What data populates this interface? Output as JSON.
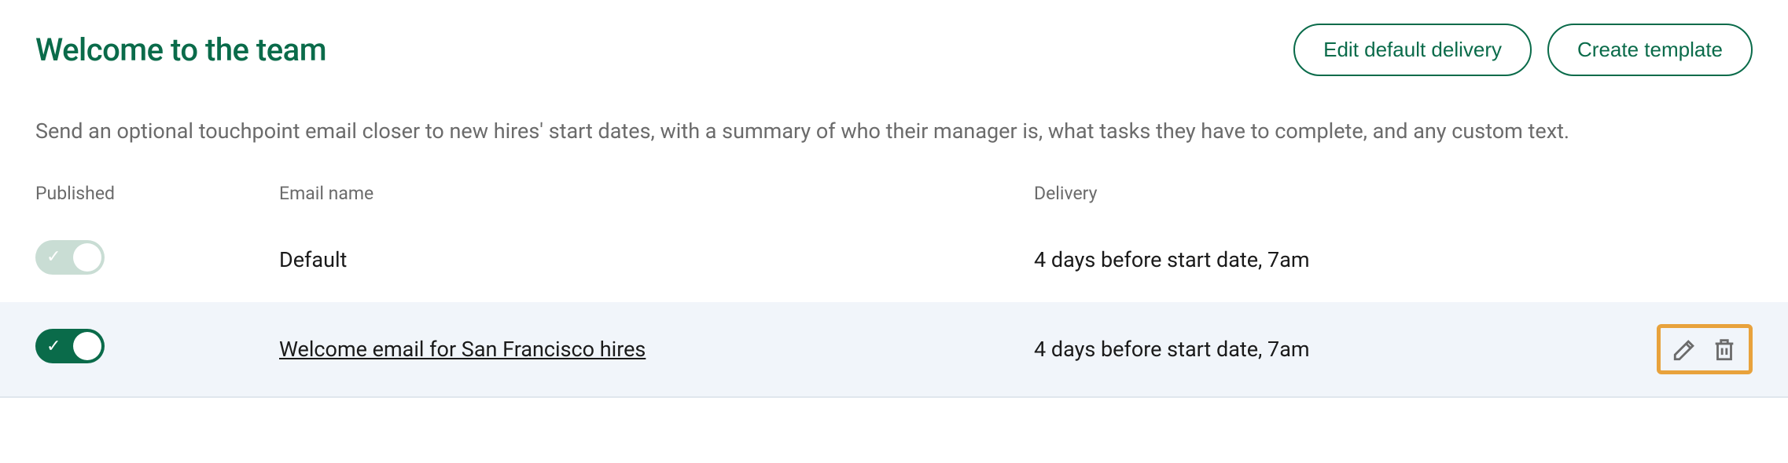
{
  "header": {
    "title": "Welcome to the team",
    "edit_delivery_label": "Edit default delivery",
    "create_template_label": "Create template"
  },
  "description": "Send an optional touchpoint email closer to new hires' start dates, with a summary of who their manager is, what tasks they have to complete, and any custom text.",
  "columns": {
    "published": "Published",
    "email_name": "Email name",
    "delivery": "Delivery"
  },
  "rows": [
    {
      "published": false,
      "name": "Default",
      "name_is_link": false,
      "delivery": "4 days before start date, 7am",
      "highlighted": false,
      "show_actions": false
    },
    {
      "published": true,
      "name": "Welcome email for San Francisco hires",
      "name_is_link": true,
      "delivery": "4 days before start date, 7am",
      "highlighted": true,
      "show_actions": true
    }
  ],
  "icons": {
    "edit": "pencil-icon",
    "delete": "trash-icon"
  }
}
